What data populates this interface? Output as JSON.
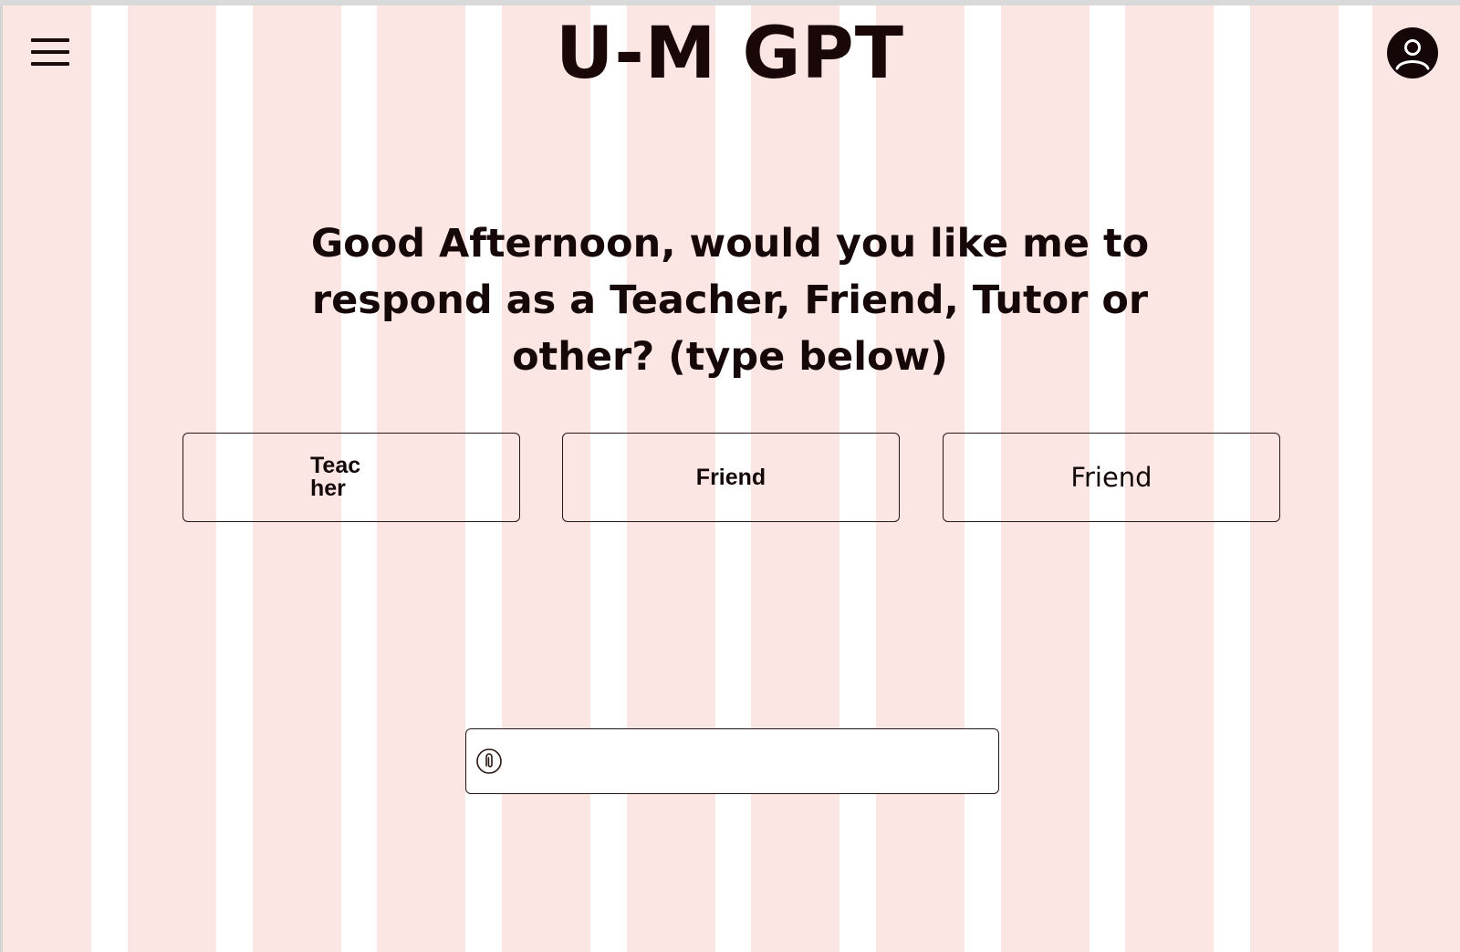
{
  "header": {
    "title": "U-M GPT",
    "menu_icon": "hamburger-menu-icon",
    "profile_icon": "user-profile-icon"
  },
  "prompt": {
    "text": "Good Afternoon, would you like me to respond as a Teacher, Friend, Tutor or other? (type below)"
  },
  "choices": [
    {
      "label": "Teacher"
    },
    {
      "label": "Friend"
    },
    {
      "label": "Friend"
    }
  ],
  "chat_input": {
    "value": "",
    "placeholder": "",
    "attach_icon": "paperclip-icon"
  },
  "colors": {
    "stripe_pink": "#fbe6e4",
    "stripe_white": "#ffffff",
    "text": "#160808",
    "border": "#2a1515"
  }
}
